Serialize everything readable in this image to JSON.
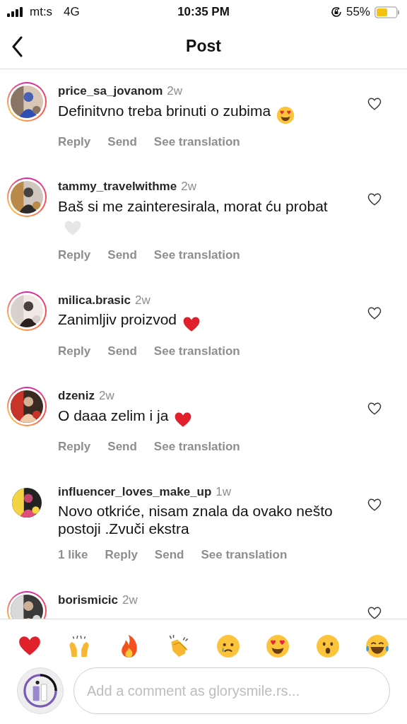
{
  "status_bar": {
    "carrier": "mt:s",
    "network": "4G",
    "time": "10:35 PM",
    "battery": "55%"
  },
  "header": {
    "title": "Post"
  },
  "comments": [
    {
      "username": "price_sa_jovanom",
      "time": "2w",
      "text": "Definitvno treba brinuti o zubima",
      "emoji": {
        "kind": "heart_eyes"
      },
      "story_ring": true,
      "actions": [
        "Reply",
        "Send",
        "See translation"
      ]
    },
    {
      "username": "tammy_travelwithme",
      "time": "2w",
      "text": "Baš si me zainteresirala, morat ću probat",
      "emoji": {
        "kind": "white_heart"
      },
      "story_ring": true,
      "actions": [
        "Reply",
        "Send",
        "See translation"
      ]
    },
    {
      "username": "milica.brasic",
      "time": "2w",
      "text": "Zanimljiv proizvod",
      "emoji": {
        "kind": "red_heart"
      },
      "story_ring": true,
      "actions": [
        "Reply",
        "Send",
        "See translation"
      ]
    },
    {
      "username": "dzeniz",
      "time": "2w",
      "text": "O daaa zelim i ja",
      "emoji": {
        "kind": "red_heart"
      },
      "story_ring": true,
      "actions": [
        "Reply",
        "Send",
        "See translation"
      ]
    },
    {
      "username": "influencer_loves_make_up",
      "time": "1w",
      "text": "Novo otkriće, nisam znala da ovako nešto postoji .Zvuči ekstra",
      "story_ring": false,
      "actions": [
        "1 like",
        "Reply",
        "Send",
        "See translation"
      ]
    },
    {
      "username": "borismicic",
      "time": "2w",
      "story_ring": true
    }
  ],
  "quick_reactions": [
    {
      "kind": "red_heart"
    },
    {
      "kind": "raised_hands"
    },
    {
      "kind": "fire"
    },
    {
      "kind": "clap"
    },
    {
      "kind": "crying"
    },
    {
      "kind": "heart_eyes"
    },
    {
      "kind": "surprised"
    },
    {
      "kind": "tears_of_joy"
    }
  ],
  "composer": {
    "placeholder": "Add a comment as glorysmile.rs..."
  }
}
